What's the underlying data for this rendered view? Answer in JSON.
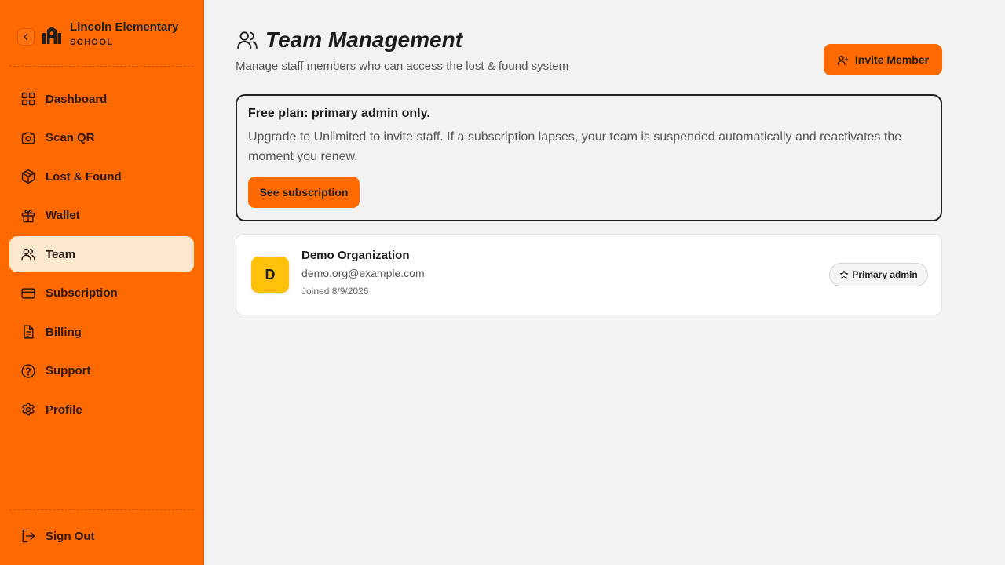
{
  "sidebar": {
    "org_name": "Lincoln Elementary",
    "org_type": "SCHOOL",
    "items": [
      {
        "label": "Dashboard",
        "icon": "grid-icon"
      },
      {
        "label": "Scan QR",
        "icon": "camera-icon"
      },
      {
        "label": "Lost & Found",
        "icon": "box-icon"
      },
      {
        "label": "Wallet",
        "icon": "gift-icon"
      },
      {
        "label": "Team",
        "icon": "users-icon",
        "active": true
      },
      {
        "label": "Subscription",
        "icon": "credit-card-icon"
      },
      {
        "label": "Billing",
        "icon": "document-icon"
      },
      {
        "label": "Support",
        "icon": "help-circle-icon"
      },
      {
        "label": "Profile",
        "icon": "gear-icon"
      }
    ],
    "signout_label": "Sign Out",
    "colors": {
      "background": "#ff6a00",
      "active_item": "#fbe8cf"
    }
  },
  "header": {
    "title": "Team Management",
    "subtitle": "Manage staff members who can access the lost & found system",
    "invite_label": "Invite Member"
  },
  "plan_notice": {
    "title": "Free plan: primary admin only.",
    "description": "Upgrade to Unlimited to invite staff. If a subscription lapses, your team is suspended automatically and reactivates the moment you renew.",
    "button_label": "See subscription"
  },
  "members": [
    {
      "initial": "D",
      "name": "Demo Organization",
      "email": "demo.org@example.com",
      "joined": "Joined 8/9/2026",
      "role": "Primary admin",
      "avatar_color": "#ffc107"
    }
  ]
}
